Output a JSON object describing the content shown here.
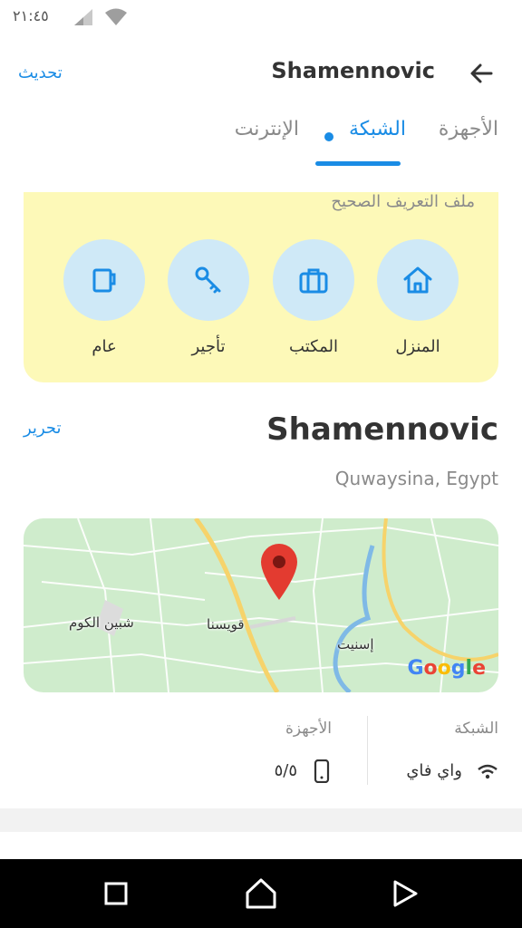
{
  "status": {
    "time": "٢١:٤٥"
  },
  "appbar": {
    "title": "Shamennovic",
    "refresh": "تحديث"
  },
  "tabs": {
    "devices": "الأجهزة",
    "network": "الشبكة",
    "internet": "الإنترنت"
  },
  "profile": {
    "hint": "ملف التعريف الصحيح",
    "items": [
      {
        "label": "المنزل",
        "icon": "home-icon"
      },
      {
        "label": "المكتب",
        "icon": "briefcase-icon"
      },
      {
        "label": "تأجير",
        "icon": "key-icon"
      },
      {
        "label": "عام",
        "icon": "cup-icon"
      }
    ]
  },
  "network": {
    "name": "Shamennovic",
    "location": "Quwaysina, Egypt",
    "edit": "تحرير"
  },
  "map": {
    "labels": [
      "شبين الكوم",
      "قويسنا",
      "إسنيت"
    ],
    "logo": "Google"
  },
  "info": {
    "network_head": "الشبكة",
    "network_value": "واي فاي",
    "devices_head": "الأجهزة",
    "devices_value": "٥/٥"
  }
}
